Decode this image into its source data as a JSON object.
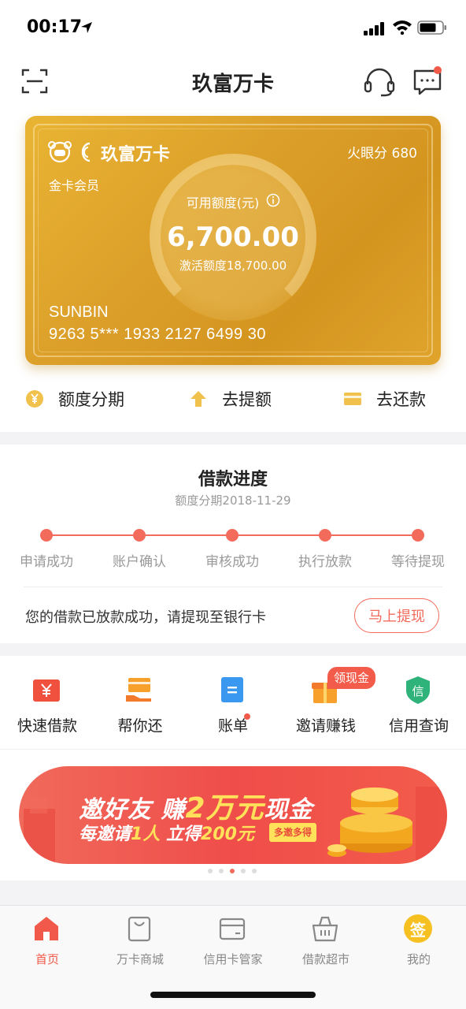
{
  "status_bar": {
    "time": "00:17"
  },
  "header": {
    "title": "玖富万卡"
  },
  "card": {
    "brand": "玖富万卡",
    "score": "火眼分 680",
    "member_level": "金卡会员",
    "available_label": "可用额度(元)",
    "available_amount": "6,700.00",
    "activated_text": "激活额度18,700.00",
    "holder_name": "SUNBIN",
    "card_number": "9263 5*** 1933 2127 6499 30"
  },
  "actions": [
    {
      "label": "额度分期",
      "icon": "yen-coin-icon"
    },
    {
      "label": "去提额",
      "icon": "arrow-up-icon"
    },
    {
      "label": "去还款",
      "icon": "card-icon"
    }
  ],
  "progress": {
    "title": "借款进度",
    "subtitle": "额度分期2018-11-29",
    "steps": [
      "申请成功",
      "账户确认",
      "审核成功",
      "执行放款",
      "等待提现"
    ],
    "message": "您的借款已放款成功，请提现至银行卡",
    "button_label": "马上提现"
  },
  "shortcuts": [
    {
      "label": "快速借款",
      "icon": "quick-loan-icon"
    },
    {
      "label": "帮你还",
      "icon": "help-repay-icon"
    },
    {
      "label": "账单",
      "icon": "bill-icon"
    },
    {
      "label": "邀请赚钱",
      "icon": "gift-icon"
    },
    {
      "label": "信用查询",
      "icon": "credit-shield-icon"
    }
  ],
  "invite_badge": "领现金",
  "banner": {
    "line1_a": "邀好友 赚",
    "line1_b": "2万元",
    "line1_c": "现金",
    "line2_a": "每邀请",
    "line2_b": "1人",
    "line2_c": " 立得",
    "line2_d": "200元",
    "tag": "多邀多得",
    "active_page": 2,
    "page_count": 5
  },
  "tabbar": [
    {
      "label": "首页",
      "icon": "home-icon",
      "active": true
    },
    {
      "label": "万卡商城",
      "icon": "shopping-bag-icon",
      "active": false
    },
    {
      "label": "信用卡管家",
      "icon": "credit-card-icon",
      "active": false
    },
    {
      "label": "借款超市",
      "icon": "basket-icon",
      "active": false
    },
    {
      "label": "我的",
      "icon": "sign-in-icon",
      "active": false
    }
  ],
  "tab_sign_text": "签",
  "colors": {
    "accent": "#f15a4a",
    "gold": "#dca02a"
  }
}
